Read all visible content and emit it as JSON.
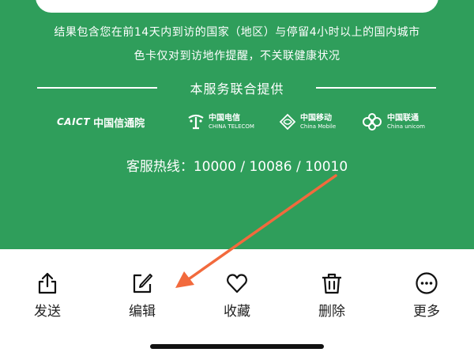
{
  "info": {
    "note_line1": "结果包含您在前14天内到访的国家（地区）与停留4小时以上的国内城市",
    "note_line2": "色卡仅对到访地作提醒，不关联健康状况",
    "provided_by": "本服务联合提供",
    "hotline": "客服热线：10000  /  10086  /  10010"
  },
  "providers": [
    {
      "name": "CAICT",
      "cn": "中国信通院",
      "icon": "caict-logo"
    },
    {
      "cn": "中国电信",
      "en": "CHINA TELECOM",
      "icon": "china-telecom-logo"
    },
    {
      "cn": "中国移动",
      "en": "China Mobile",
      "icon": "china-mobile-logo"
    },
    {
      "cn": "中国联通",
      "en": "China unicom",
      "icon": "china-unicom-logo"
    }
  ],
  "toolbar": {
    "items": [
      {
        "label": "发送",
        "icon": "share-icon"
      },
      {
        "label": "编辑",
        "icon": "edit-icon"
      },
      {
        "label": "收藏",
        "icon": "heart-icon"
      },
      {
        "label": "删除",
        "icon": "trash-icon"
      },
      {
        "label": "更多",
        "icon": "more-icon"
      }
    ]
  },
  "colors": {
    "brand_green": "#2f9e5b",
    "annotation_arrow": "#f26a3d",
    "toolbar_text": "#222222"
  }
}
